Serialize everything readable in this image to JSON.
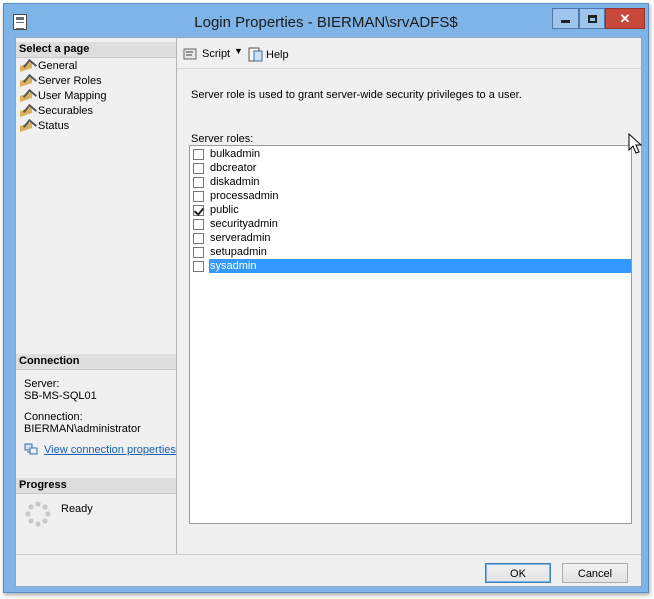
{
  "window": {
    "title": "Login Properties - BIERMAN\\srvADFS$"
  },
  "nav": {
    "header": "Select a page",
    "items": [
      {
        "label": "General"
      },
      {
        "label": "Server Roles"
      },
      {
        "label": "User Mapping"
      },
      {
        "label": "Securables"
      },
      {
        "label": "Status"
      }
    ]
  },
  "connection": {
    "header": "Connection",
    "server_label": "Server:",
    "server_value": "SB-MS-SQL01",
    "connection_label": "Connection:",
    "connection_value": "BIERMAN\\administrator",
    "view_link": "View connection properties"
  },
  "progress": {
    "header": "Progress",
    "status": "Ready"
  },
  "toolbar": {
    "script_label": "Script",
    "help_label": "Help"
  },
  "main": {
    "description": "Server role is used to grant server-wide security privileges to a user.",
    "roles_label": "Server roles:",
    "roles": [
      {
        "name": "bulkadmin",
        "checked": false
      },
      {
        "name": "dbcreator",
        "checked": false
      },
      {
        "name": "diskadmin",
        "checked": false
      },
      {
        "name": "processadmin",
        "checked": false
      },
      {
        "name": "public",
        "checked": true
      },
      {
        "name": "securityadmin",
        "checked": false
      },
      {
        "name": "serveradmin",
        "checked": false
      },
      {
        "name": "setupadmin",
        "checked": false
      },
      {
        "name": "sysadmin",
        "checked": false,
        "selected": true
      }
    ]
  },
  "buttons": {
    "ok": "OK",
    "cancel": "Cancel"
  },
  "colors": {
    "titlebar": "#7fb4e6",
    "close": "#c7493a",
    "selection": "#3399ff",
    "link": "#1a5fb4"
  },
  "icons": {
    "app": "app-window-icon",
    "page": "page-wrench-icon",
    "script": "script-icon",
    "help": "help-icon",
    "connection": "connection-properties-icon",
    "progress": "progress-spinner-icon"
  }
}
